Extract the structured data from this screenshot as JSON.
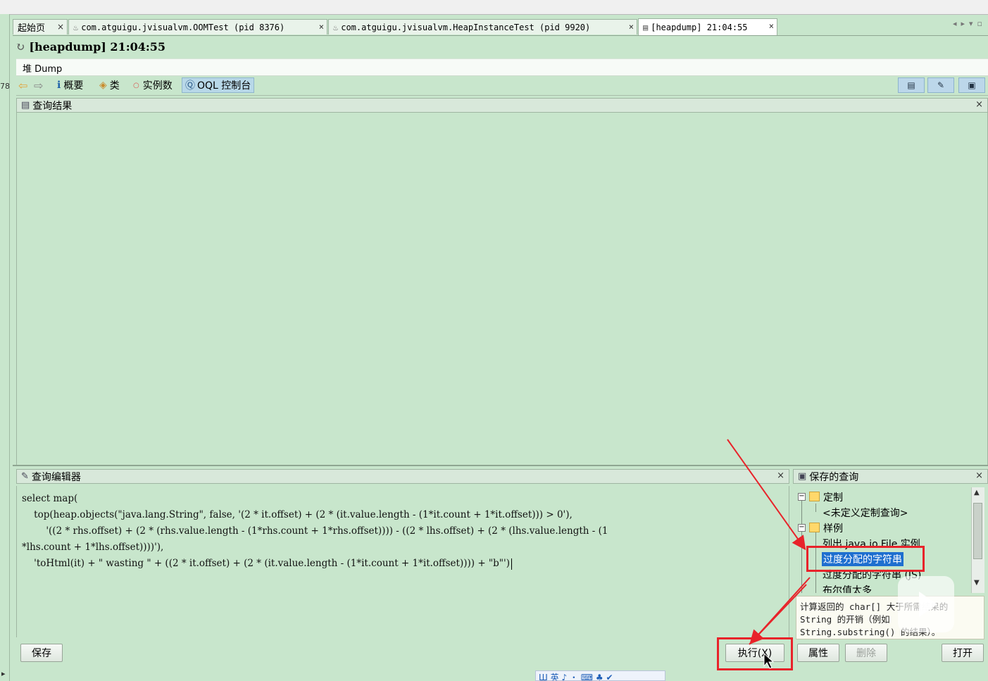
{
  "tabs": [
    {
      "label": "起始页",
      "close": "×"
    },
    {
      "label": "com.atguigu.jvisualvm.OOMTest (pid 8376)",
      "close": "×"
    },
    {
      "label": "com.atguigu.jvisualvm.HeapInstanceTest (pid 9920)",
      "close": "×"
    },
    {
      "label": "[heapdump] 21:04:55",
      "close": "×"
    }
  ],
  "left_edge_label": "78",
  "page_title": "[heapdump] 21:04:55",
  "dump_label": "堆 Dump",
  "toolbar": {
    "summary": "概要",
    "classes": "类",
    "instances": "实例数",
    "oql_console": "OQL 控制台"
  },
  "results_panel": {
    "title": "查询结果",
    "close": "×"
  },
  "editor_panel": {
    "title": "查询编辑器",
    "close": "×",
    "code_lines": [
      "select map(",
      "    top(heap.objects(\"java.lang.String\", false, '(2 * it.offset) + (2 * (it.value.length - (1*it.count + 1*it.offset))) > 0'),",
      "        '((2 * rhs.offset) + (2 * (rhs.value.length - (1*rhs.count + 1*rhs.offset)))) - ((2 * lhs.offset) + (2 * (lhs.value.length - (1",
      "*lhs.count + 1*lhs.offset))))'),",
      "    'toHtml(it) + \" wasting \" + ((2 * it.offset) + (2 * (it.value.length - (1*it.count + 1*it.offset)))) + \"b\"')"
    ],
    "save_button": "保存",
    "run_button": "执行(X)"
  },
  "saved_panel": {
    "title": "保存的查询",
    "close": "×",
    "tree": {
      "custom_folder": "定制",
      "custom_placeholder": "<未定义定制查询>",
      "samples_folder": "样例",
      "items": [
        "列出 java.io.File 实例",
        "过度分配的字符串",
        "过度分配的字符串 (JS)",
        "布尔值太多"
      ]
    },
    "description_lines": [
      "计算返回的 char[] 大于所需结果的",
      "String 的开销（例如",
      "String.substring() 的结果）。"
    ],
    "properties_button": "属性",
    "delete_button": "删除",
    "open_button": "打开"
  },
  "taskbar_text": "Ш 英 ♪ ・ ⌨ ♣ ✔",
  "colors": {
    "background": "#c8e6cc",
    "selection": "#1e6fcf",
    "annotation": "#e8232a"
  }
}
